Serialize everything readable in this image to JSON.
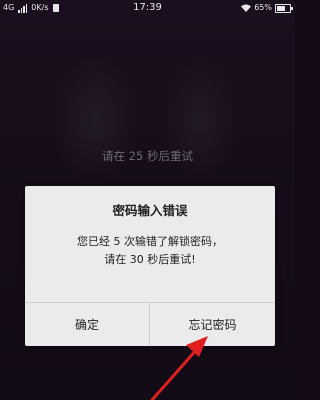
{
  "statusbar": {
    "network": "4G",
    "speed": "0K/s",
    "time": "17:39",
    "battery": "65%",
    "battery_level": 0.65,
    "icons": [
      "signal-icon",
      "sim-icon",
      "wifi-icon",
      "battery-icon"
    ]
  },
  "lockscreen": {
    "retry_notice": "请在 25 秒后重试"
  },
  "dialog": {
    "title": "密码输入错误",
    "message_line1": "您已经 5 次输错了解锁密码，",
    "message_line2": "请在 30 秒后重试!",
    "confirm_label": "确定",
    "forgot_label": "忘记密码"
  },
  "annotation": {
    "arrow_color": "#e02020"
  }
}
